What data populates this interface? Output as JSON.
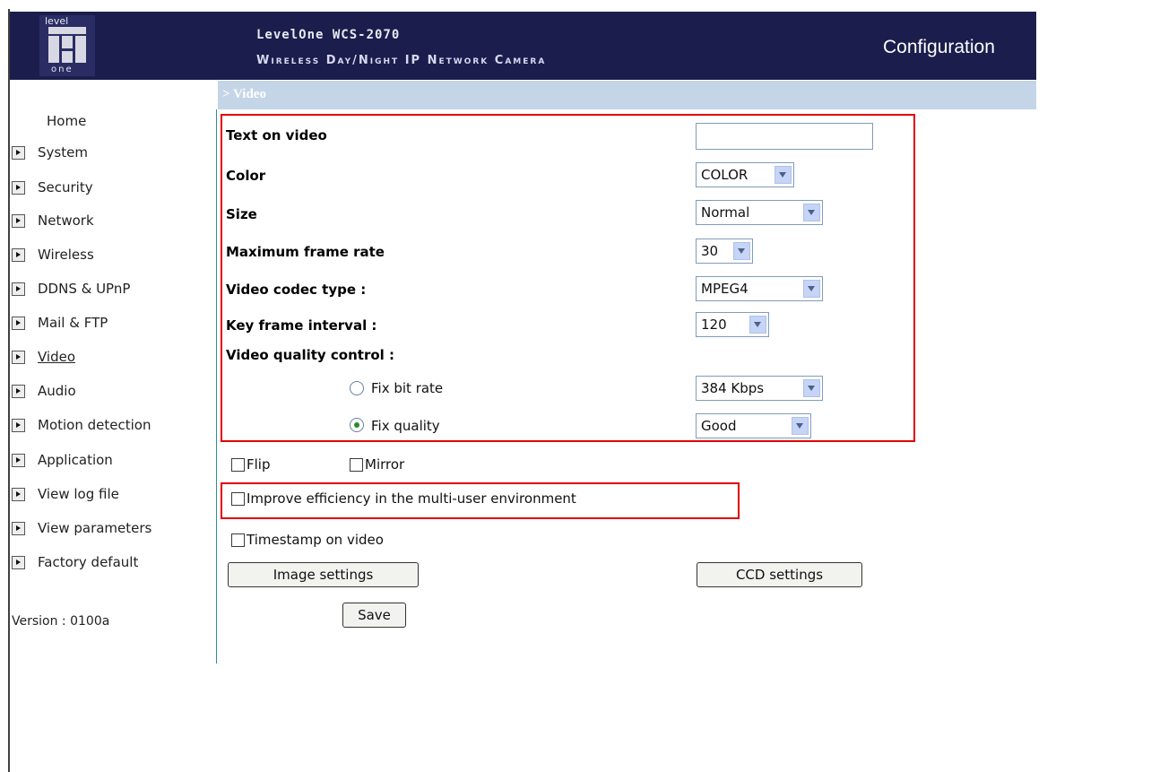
{
  "header": {
    "logo_top": "level",
    "logo_bottom": "one",
    "brand": "LevelOne WCS-2070",
    "subtitle": "Wireless Day/Night IP Network Camera",
    "config": "Configuration"
  },
  "breadcrumb": "> Video",
  "sidebar": {
    "home": "Home",
    "items": [
      {
        "label": "System"
      },
      {
        "label": "Security"
      },
      {
        "label": "Network"
      },
      {
        "label": "Wireless"
      },
      {
        "label": "DDNS & UPnP"
      },
      {
        "label": "Mail & FTP"
      },
      {
        "label": "Video"
      },
      {
        "label": "Audio"
      },
      {
        "label": "Motion detection"
      },
      {
        "label": "Application"
      },
      {
        "label": "View log file"
      },
      {
        "label": "View parameters"
      },
      {
        "label": "Factory default"
      }
    ],
    "version": "Version : 0100a"
  },
  "form": {
    "text_on_video_label": "Text on video",
    "text_on_video_value": "",
    "color_label": "Color",
    "color_value": "COLOR",
    "size_label": "Size",
    "size_value": "Normal",
    "frame_rate_label": "Maximum frame rate",
    "frame_rate_value": "30",
    "codec_label": "Video codec type :",
    "codec_value": "MPEG4",
    "key_frame_label": "Key frame interval :",
    "key_frame_value": "120",
    "quality_control_label": "Video quality control :",
    "fix_bit_rate_label": "Fix bit rate",
    "fix_bit_rate_value": "384 Kbps",
    "fix_quality_label": "Fix quality",
    "fix_quality_value": "Good",
    "flip_label": "Flip",
    "mirror_label": "Mirror",
    "improve_label": "Improve efficiency in the multi-user environment",
    "timestamp_label": "Timestamp on video",
    "image_settings_label": "Image settings",
    "ccd_settings_label": "CCD settings",
    "save_label": "Save"
  },
  "colors": {
    "header_bg": "#1b1d4d",
    "breadcrumb_bg": "#c4d5e7",
    "highlight": "#e00000"
  }
}
